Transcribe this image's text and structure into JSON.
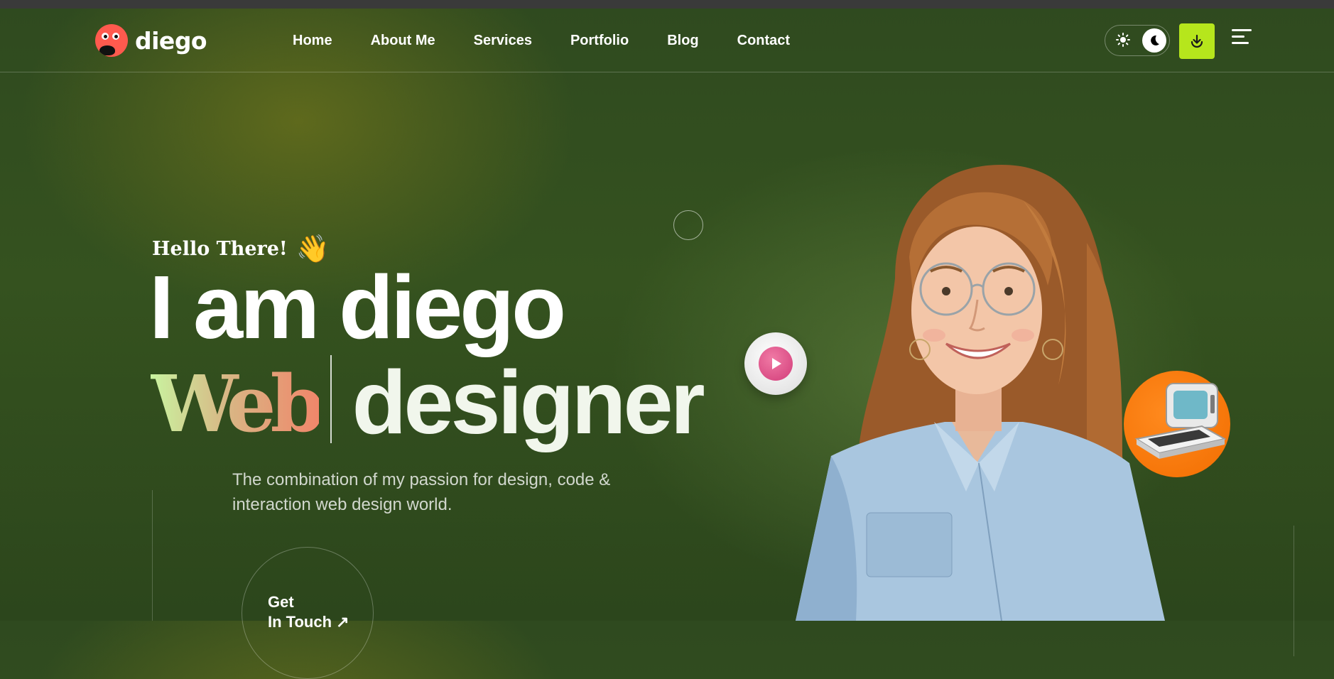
{
  "brand": {
    "name": "diego",
    "logo_icon": "face-logo-icon",
    "accent": "#b6e61c",
    "logo_color": "#ff5a4e"
  },
  "nav": {
    "items": [
      {
        "label": "Home"
      },
      {
        "label": "About Me"
      },
      {
        "label": "Services"
      },
      {
        "label": "Portfolio"
      },
      {
        "label": "Blog"
      },
      {
        "label": "Contact"
      }
    ]
  },
  "header_actions": {
    "theme_toggle": {
      "light_icon": "sun-icon",
      "dark_icon": "moon-icon",
      "active": "dark"
    },
    "download_icon": "download-icon",
    "menu_icon": "menu-icon"
  },
  "hero": {
    "greeting": "Hello There!",
    "greeting_icon": "waving-hand-icon",
    "wave_emoji": "👋",
    "headline_line1": "I am diego",
    "headline_role_highlight": "Web",
    "headline_role_rest": "designer",
    "description": "The combination of my passion for design, code & interaction web design world.",
    "cta_line1": "Get",
    "cta_line2": "In Touch ↗"
  },
  "media": {
    "play_icon": "play-icon",
    "badge_icon": "retro-computer-icon",
    "portrait": "smiling-woman-portrait"
  }
}
